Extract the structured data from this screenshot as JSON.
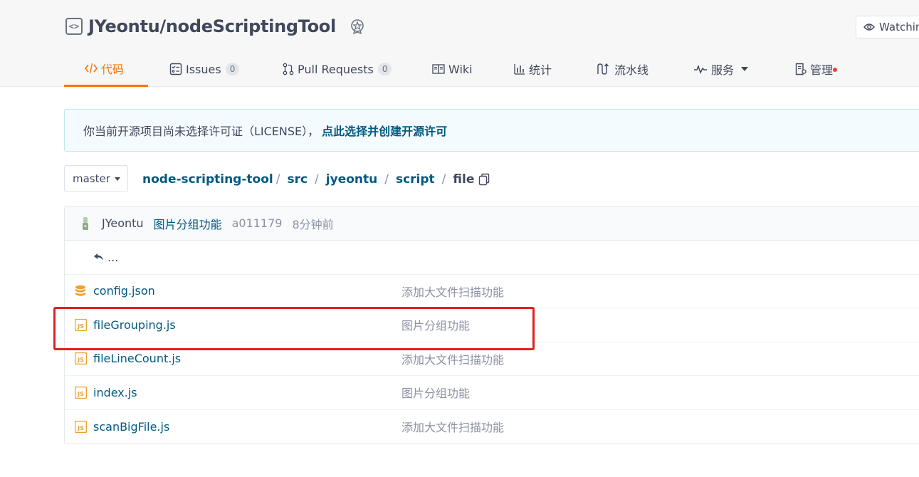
{
  "repo": {
    "owner_and_name": "JYeontu/nodeScriptingTool",
    "watch_label": "Watchin"
  },
  "tabs": [
    {
      "label": "代码",
      "icon": "code-icon",
      "active": true
    },
    {
      "label": "Issues",
      "icon": "issue-icon",
      "count": "0"
    },
    {
      "label": "Pull Requests",
      "icon": "pull-request-icon",
      "count": "0"
    },
    {
      "label": "Wiki",
      "icon": "book-icon"
    },
    {
      "label": "统计",
      "icon": "bar-chart-icon"
    },
    {
      "label": "流水线",
      "icon": "pipeline-icon"
    },
    {
      "label": "服务",
      "icon": "pulse-icon"
    },
    {
      "label": "管理",
      "icon": "manage-icon"
    }
  ],
  "notice": {
    "text": "你当前开源项目尚未选择许可证（LICENSE），",
    "link": "点此选择并创建开源许可"
  },
  "branch": {
    "name": "master"
  },
  "breadcrumb": [
    "node-scripting-tool",
    "src",
    "jyeontu",
    "script",
    "file"
  ],
  "commit": {
    "author": "JYeontu",
    "message": "图片分组功能",
    "sha": "a011179",
    "time": "8分钟前"
  },
  "up_label": "...",
  "files": [
    {
      "name": "config.json",
      "message": "添加大文件扫描功能",
      "icon": "database-icon"
    },
    {
      "name": "fileGrouping.js",
      "message": "图片分组功能",
      "icon": "js-file-icon"
    },
    {
      "name": "fileLineCount.js",
      "message": "添加大文件扫描功能",
      "icon": "js-file-icon"
    },
    {
      "name": "index.js",
      "message": "图片分组功能",
      "icon": "js-file-icon"
    },
    {
      "name": "scanBigFile.js",
      "message": "添加大文件扫描功能",
      "icon": "js-file-icon"
    }
  ],
  "colors": {
    "accent": "#fe7300",
    "link": "#005980",
    "highlight_box": "#e02020"
  }
}
